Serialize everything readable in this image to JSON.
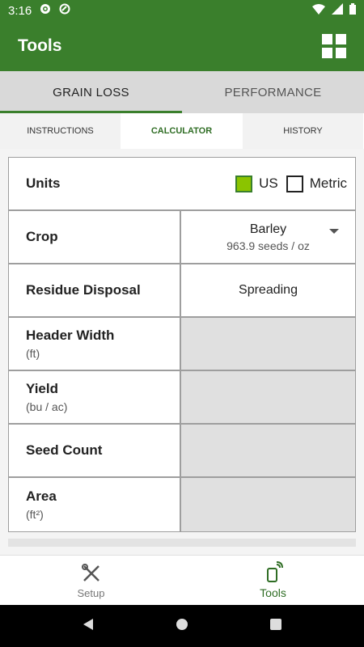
{
  "status_bar": {
    "time": "3:16"
  },
  "app_bar": {
    "title": "Tools"
  },
  "main_tabs": [
    {
      "label": "GRAIN LOSS",
      "active": true
    },
    {
      "label": "PERFORMANCE",
      "active": false
    }
  ],
  "sub_tabs": [
    {
      "label": "INSTRUCTIONS",
      "active": false
    },
    {
      "label": "CALCULATOR",
      "active": true
    },
    {
      "label": "HISTORY",
      "active": false
    }
  ],
  "calculator": {
    "units": {
      "label": "Units",
      "us_label": "US",
      "us_checked": true,
      "metric_label": "Metric",
      "metric_checked": false
    },
    "crop": {
      "label": "Crop",
      "value": "Barley",
      "seeds": "963.9 seeds / oz"
    },
    "residue": {
      "label": "Residue Disposal",
      "value": "Spreading"
    },
    "header_width": {
      "label": "Header Width",
      "unit": "(ft)"
    },
    "yield": {
      "label": "Yield",
      "unit": "(bu / ac)"
    },
    "seed_count": {
      "label": "Seed Count"
    },
    "area": {
      "label": "Area",
      "unit": "(ft²)"
    }
  },
  "bottom_nav": [
    {
      "label": "Setup",
      "icon": "wrench-screwdriver-icon",
      "active": false
    },
    {
      "label": "Tools",
      "icon": "phone-signal-icon",
      "active": true
    }
  ],
  "colors": {
    "primary": "#3a7f2c",
    "accent": "#8bc400",
    "tab_bg": "#d9d9d9"
  }
}
